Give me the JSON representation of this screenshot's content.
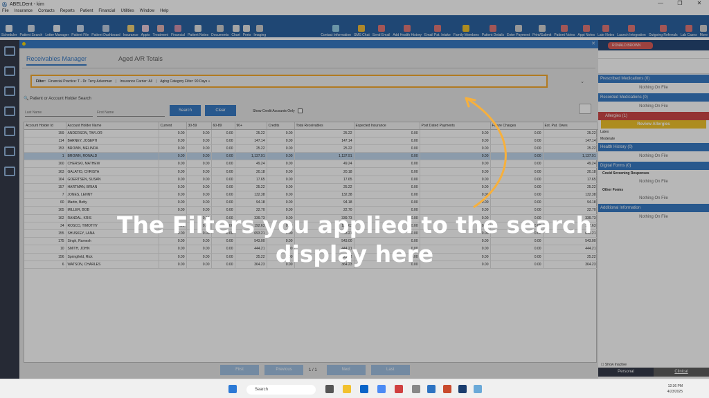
{
  "window": {
    "title": "ABELDent - kim",
    "controls": [
      "—",
      "❐",
      "✕"
    ]
  },
  "menu": [
    "File",
    "Insurance",
    "Contacts",
    "Reports",
    "Patient",
    "Financial",
    "Utilities",
    "Window",
    "Help"
  ],
  "toolbar_left": [
    {
      "label": "Scheduler",
      "color": "#e4e9f0"
    },
    {
      "label": "Patient Search",
      "color": "#cfd9e6"
    },
    {
      "label": "Letter Manager",
      "color": "#e4e9f0"
    },
    {
      "label": "Patient File",
      "color": "#c8d8ea"
    },
    {
      "label": "Patient Dashboard",
      "color": "#b9c9dd"
    },
    {
      "label": "Insurance",
      "color": "#f0d070"
    },
    {
      "label": "Appts",
      "color": "#e7c7d7"
    },
    {
      "label": "Treatment",
      "color": "#e0b0b0"
    },
    {
      "label": "Financial",
      "color": "#d08ca8"
    },
    {
      "label": "Patient Notes",
      "color": "#e4e4e4"
    },
    {
      "label": "Documents",
      "color": "#cccccc"
    },
    {
      "label": "Chart",
      "color": "#e4e4e4"
    },
    {
      "label": "Perio",
      "color": "#e4e4e4"
    },
    {
      "label": "Imaging",
      "color": "#cccccc"
    }
  ],
  "toolbar_right": [
    {
      "label": "Contact Information",
      "color": "#8ecde8"
    },
    {
      "label": "SMS Chat",
      "color": "#f0b830"
    },
    {
      "label": "Send Email",
      "color": "#e07070"
    },
    {
      "label": "Add Health History",
      "color": "#e07070"
    },
    {
      "label": "Email Pat. Intake",
      "color": "#e07070"
    },
    {
      "label": "Family Members",
      "color": "#f0c020"
    },
    {
      "label": "Patient Details",
      "color": "#e07070"
    },
    {
      "label": "Enter Payment",
      "color": "#d0d0d0"
    },
    {
      "label": "Print/Submit",
      "color": "#d0d0d0"
    },
    {
      "label": "Patient Notes",
      "color": "#e07070"
    },
    {
      "label": "Appt Notes",
      "color": "#e07070"
    },
    {
      "label": "Late Notes",
      "color": "#e07070"
    },
    {
      "label": "Launch Integration",
      "color": "#e07070"
    },
    {
      "label": "Outgoing Referrals",
      "color": "#e07070"
    },
    {
      "label": "Lab Cases",
      "color": "#e07070"
    },
    {
      "label": "More",
      "color": "#d0d0d0"
    }
  ],
  "tabs": [
    "Receivables Manager",
    "Aged A/R Totals"
  ],
  "filter": {
    "label": "Filter:",
    "practice": "Financial Practice:  T - Dr. Terry Ackerman",
    "carrier": "Insurance Carrier:  All",
    "aging": "Aging Category Filter:  90 Days »",
    "chevron": "⌄"
  },
  "search": {
    "title": "Patient or Account Holder Search",
    "last_name_placeholder": "Last Name",
    "first_name_placeholder": "First Name",
    "search_btn": "Search",
    "clear_btn": "Clear",
    "credit_label": "Show Credit Accounts Only"
  },
  "table": {
    "headers": [
      "Account Holder Id",
      "Account Holder Name",
      "Current",
      "30-59",
      "60-89",
      "90+",
      "Credits",
      "Total Receivables",
      "Expected Insurance",
      "Post Dated Payments",
      "Future Charges",
      "Est. Pat. Owes"
    ],
    "rows": [
      [
        "159",
        "ANDERSON, TAYLOR",
        "0.00",
        "0.00",
        "0.00",
        "25.22",
        "0.00",
        "25.22",
        "0.00",
        "0.00",
        "0.00",
        "25.22"
      ],
      [
        "114",
        "BARNEY, JOSEPH",
        "0.00",
        "0.00",
        "0.00",
        "147.14",
        "0.00",
        "147.14",
        "0.00",
        "0.00",
        "0.00",
        "147.14"
      ],
      [
        "153",
        "BROWN, MELINDA",
        "0.00",
        "0.00",
        "0.00",
        "25.22",
        "0.00",
        "25.22",
        "0.00",
        "0.00",
        "0.00",
        "25.22"
      ],
      [
        "1",
        "BROWN, RONALD",
        "0.00",
        "0.00",
        "0.00",
        "1,137.91",
        "0.00",
        "1,137.91",
        "0.00",
        "0.00",
        "0.00",
        "1,137.91"
      ],
      [
        "160",
        "CHERSKI, MATHEW",
        "0.00",
        "0.00",
        "0.00",
        "49.24",
        "0.00",
        "49.24",
        "0.00",
        "0.00",
        "0.00",
        "49.24"
      ],
      [
        "163",
        "GALATIO, CHRISTA",
        "0.00",
        "0.00",
        "0.00",
        "20.18",
        "0.00",
        "20.18",
        "0.00",
        "0.00",
        "0.00",
        "20.18"
      ],
      [
        "164",
        "GOERTSEN, SUSAN",
        "0.00",
        "0.00",
        "0.00",
        "17.65",
        "0.00",
        "17.65",
        "0.00",
        "0.00",
        "0.00",
        "17.65"
      ],
      [
        "157",
        "HARTMAN, BRIAN",
        "0.00",
        "0.00",
        "0.00",
        "25.22",
        "0.00",
        "25.22",
        "0.00",
        "0.00",
        "0.00",
        "25.22"
      ],
      [
        "7",
        "JONES, LENNY",
        "0.00",
        "0.00",
        "0.00",
        "132.38",
        "0.00",
        "132.38",
        "0.00",
        "0.00",
        "0.00",
        "132.38"
      ],
      [
        "60",
        "Martin, Betty",
        "0.00",
        "0.00",
        "0.00",
        "94.18",
        "0.00",
        "94.18",
        "0.00",
        "0.00",
        "0.00",
        "94.18"
      ],
      [
        "165",
        "MILLER, BOB",
        "0.00",
        "0.00",
        "0.00",
        "22.70",
        "0.00",
        "22.70",
        "0.00",
        "0.00",
        "0.00",
        "22.70"
      ],
      [
        "162",
        "RANDAL, KRIS",
        "0.00",
        "0.00",
        "0.00",
        "339.73",
        "0.00",
        "339.73",
        "0.00",
        "0.00",
        "0.00",
        "339.73"
      ],
      [
        "34",
        "ROSCO, TIMOTHY",
        "0.00",
        "0.00",
        "0.00",
        "192.63",
        "0.00",
        "192.63",
        "0.00",
        "0.00",
        "0.00",
        "192.63"
      ],
      [
        "155",
        "SHUSKEY, LANA",
        "0.00",
        "0.00",
        "0.00",
        "693.21",
        "0.00",
        "693.21",
        "0.00",
        "0.00",
        "0.00",
        "693.21"
      ],
      [
        "175",
        "Singh, Ramesh",
        "0.00",
        "0.00",
        "0.00",
        "543.00",
        "0.00",
        "543.00",
        "0.00",
        "0.00",
        "0.00",
        "543.00"
      ],
      [
        "10",
        "SMITH, JOHN",
        "0.00",
        "0.00",
        "0.00",
        "444.21",
        "0.00",
        "444.21",
        "0.00",
        "0.00",
        "0.00",
        "444.21"
      ],
      [
        "156",
        "Springfield, Rick",
        "0.00",
        "0.00",
        "0.00",
        "25.22",
        "0.00",
        "25.22",
        "0.00",
        "0.00",
        "0.00",
        "25.22"
      ],
      [
        "6",
        "WATSON, CHARLES",
        "0.00",
        "0.00",
        "0.00",
        "364.23",
        "0.00",
        "364.23",
        "0.00",
        "0.00",
        "0.00",
        "364.23"
      ]
    ]
  },
  "pager": {
    "first": "First",
    "previous": "Previous",
    "page": "1 / 1",
    "next": "Next",
    "last": "Last"
  },
  "patient": {
    "name": "RONALD BROWN"
  },
  "right_panel": {
    "prescribed": "Prescribed Medications (0)",
    "recorded": "Recorded Medications (0)",
    "allergies": "Allergies (1)",
    "review": "Review Allergies",
    "latex_title": "Latex",
    "latex_level": "Moderate",
    "health": "Health History (0)",
    "forms": "Digital Forms (0)",
    "covid": "Covid Screening Responses",
    "other_forms": "Other Forms",
    "additional": "Additional Information",
    "nothing": "Nothing On File",
    "show_inactive": "Show Inactive",
    "tab_personal": "Personal",
    "tab_clinical": "Clinical"
  },
  "taskbar": {
    "search": "Search",
    "time": "12:36 PM",
    "date": "4/23/2025"
  },
  "caption": "The Filters you applied to the search display here",
  "colors": {
    "accent": "#2d73c2",
    "highlight": "#f7a623",
    "header": "#1f5b9c"
  }
}
